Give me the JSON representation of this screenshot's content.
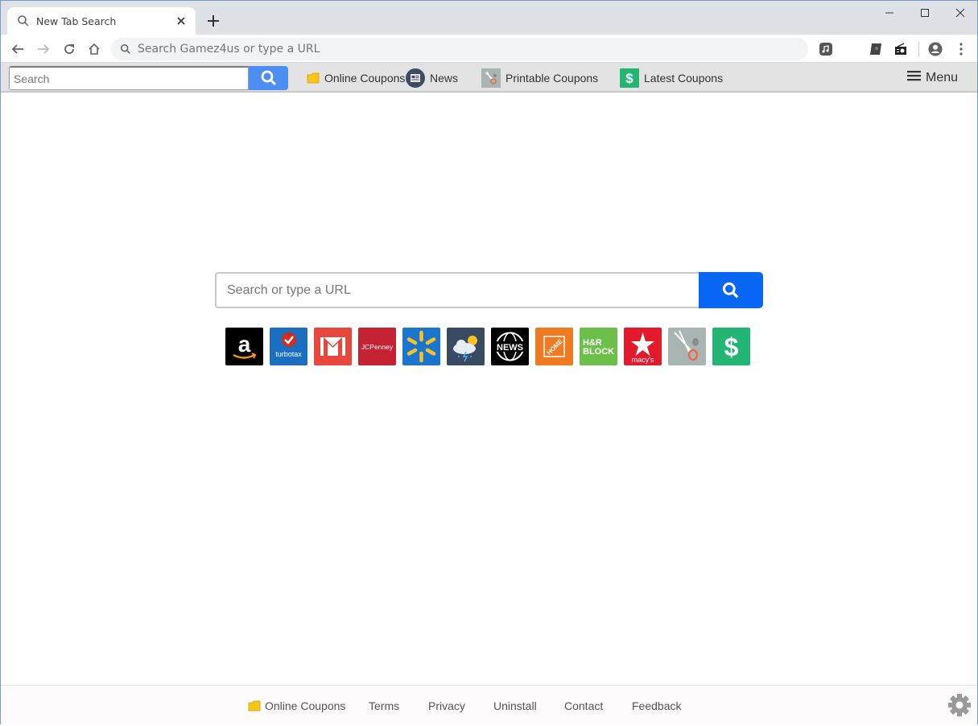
{
  "browser": {
    "tab_title": "New Tab Search",
    "omnibox_placeholder": "Search Gamez4us or type a URL"
  },
  "bookmarks_bar": {
    "search_placeholder": "Search",
    "links": [
      {
        "label": "Online Coupons",
        "icon": "folder-icon"
      },
      {
        "label": "News",
        "icon": "news-icon"
      },
      {
        "label": "Printable Coupons",
        "icon": "scissors-icon"
      },
      {
        "label": "Latest Coupons",
        "icon": "dollar-icon"
      }
    ],
    "menu_label": "Menu"
  },
  "main": {
    "search_placeholder": "Search or type a URL",
    "tiles": [
      {
        "name": "amazon",
        "color": "#000000",
        "label": "a"
      },
      {
        "name": "turbotax",
        "color": "#1a6fc0",
        "label": "turbotax"
      },
      {
        "name": "gmail",
        "color": "#e7473c",
        "label": ""
      },
      {
        "name": "jcpenney",
        "color": "#c52233",
        "label": "JCPenney"
      },
      {
        "name": "walmart",
        "color": "#1a75cf",
        "label": ""
      },
      {
        "name": "weather",
        "color": "#3b4a63",
        "label": ""
      },
      {
        "name": "news",
        "color": "#000000",
        "label": "NEWS"
      },
      {
        "name": "home-depot",
        "color": "#f07a22",
        "label": "THE HOME DEPOT"
      },
      {
        "name": "hr-block",
        "color": "#6cc04a",
        "label": "H&R BLOCK"
      },
      {
        "name": "macys",
        "color": "#e21a2c",
        "label": "macy's"
      },
      {
        "name": "printable-coupons",
        "color": "#a9b5b2",
        "label": ""
      },
      {
        "name": "latest-coupons",
        "color": "#22b573",
        "label": "$"
      }
    ]
  },
  "footer": {
    "links": [
      "Online Coupons",
      "Terms",
      "Privacy",
      "Uninstall",
      "Contact",
      "Feedback"
    ]
  }
}
